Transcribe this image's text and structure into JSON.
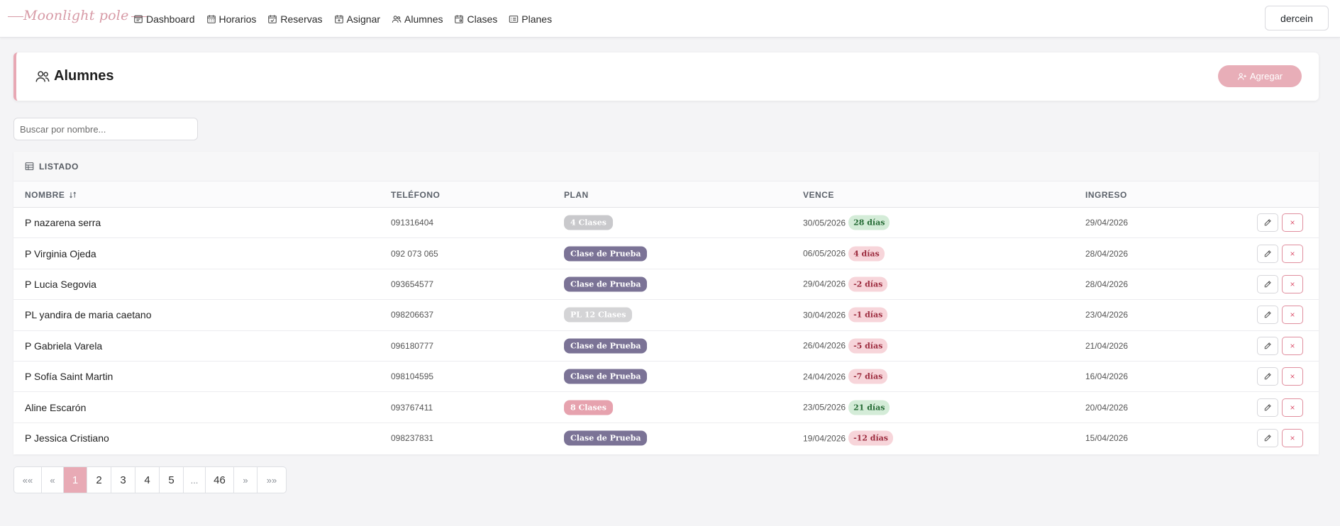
{
  "app": {
    "brand": "Moonlight pole",
    "user": "dercein"
  },
  "nav": [
    {
      "label": "Dashboard",
      "icon": "dashboard-icon"
    },
    {
      "label": "Horarios",
      "icon": "calendar-grid-icon"
    },
    {
      "label": "Reservas",
      "icon": "calendar-check-icon"
    },
    {
      "label": "Asignar",
      "icon": "calendar-plus-icon"
    },
    {
      "label": "Alumnes",
      "icon": "people-icon"
    },
    {
      "label": "Clases",
      "icon": "calendar-icon"
    },
    {
      "label": "Planes",
      "icon": "card-list-icon"
    }
  ],
  "page": {
    "title": "Alumnes",
    "add_label": "Agregar"
  },
  "search": {
    "placeholder": "Buscar por nombre..."
  },
  "table": {
    "card_title": "LISTADO",
    "columns": {
      "nombre": "NOMBRE",
      "telefono": "TELÉFONO",
      "plan": "PLAN",
      "vence": "VENCE",
      "ingreso": "INGRESO"
    },
    "rows": [
      {
        "nombre": "P nazarena serra",
        "telefono": "091316404",
        "plan": "4 Clases",
        "plan_color": "#c9c9cc",
        "vence": "30/05/2026",
        "dias": "28 días",
        "dias_status": "ok",
        "ingreso": "29/04/2026"
      },
      {
        "nombre": "P Virginia Ojeda",
        "telefono": "092 073 065",
        "plan": "Clase de Prueba",
        "plan_color": "#7b7396",
        "vence": "06/05/2026",
        "dias": "4 días",
        "dias_status": "warn",
        "ingreso": "28/04/2026"
      },
      {
        "nombre": "P Lucia Segovia",
        "telefono": "093654577",
        "plan": "Clase de Prueba",
        "plan_color": "#7b7396",
        "vence": "29/04/2026",
        "dias": "-2 días",
        "dias_status": "warn",
        "ingreso": "28/04/2026"
      },
      {
        "nombre": "PL yandira de maria caetano",
        "telefono": "098206637",
        "plan": "PL 12 Clases",
        "plan_color": "#d4d4d6",
        "vence": "30/04/2026",
        "dias": "-1 días",
        "dias_status": "warn",
        "ingreso": "23/04/2026"
      },
      {
        "nombre": "P Gabriela Varela",
        "telefono": "096180777",
        "plan": "Clase de Prueba",
        "plan_color": "#7b7396",
        "vence": "26/04/2026",
        "dias": "-5 días",
        "dias_status": "warn",
        "ingreso": "21/04/2026"
      },
      {
        "nombre": "P Sofía Saint Martin",
        "telefono": "098104595",
        "plan": "Clase de Prueba",
        "plan_color": "#7b7396",
        "vence": "24/04/2026",
        "dias": "-7 días",
        "dias_status": "warn",
        "ingreso": "16/04/2026"
      },
      {
        "nombre": "Aline Escarón",
        "telefono": "093767411",
        "plan": "8 Clases",
        "plan_color": "#e6a2ae",
        "vence": "23/05/2026",
        "dias": "21 días",
        "dias_status": "ok",
        "ingreso": "20/04/2026"
      },
      {
        "nombre": "P Jessica Cristiano",
        "telefono": "098237831",
        "plan": "Clase de Prueba",
        "plan_color": "#7b7396",
        "vence": "19/04/2026",
        "dias": "-12 días",
        "dias_status": "warn",
        "ingreso": "15/04/2026"
      }
    ]
  },
  "pagination": {
    "items": [
      "««",
      "«",
      "1",
      "2",
      "3",
      "4",
      "5",
      "...",
      "46",
      "»",
      "»»"
    ],
    "active": "1"
  },
  "colors": {
    "accent": "#e8aab5",
    "ok_bg": "#d4ecd8",
    "ok_fg": "#256b35",
    "warn_bg": "#f7d5da",
    "warn_fg": "#9c2b3e",
    "delete": "#dd5a73"
  }
}
